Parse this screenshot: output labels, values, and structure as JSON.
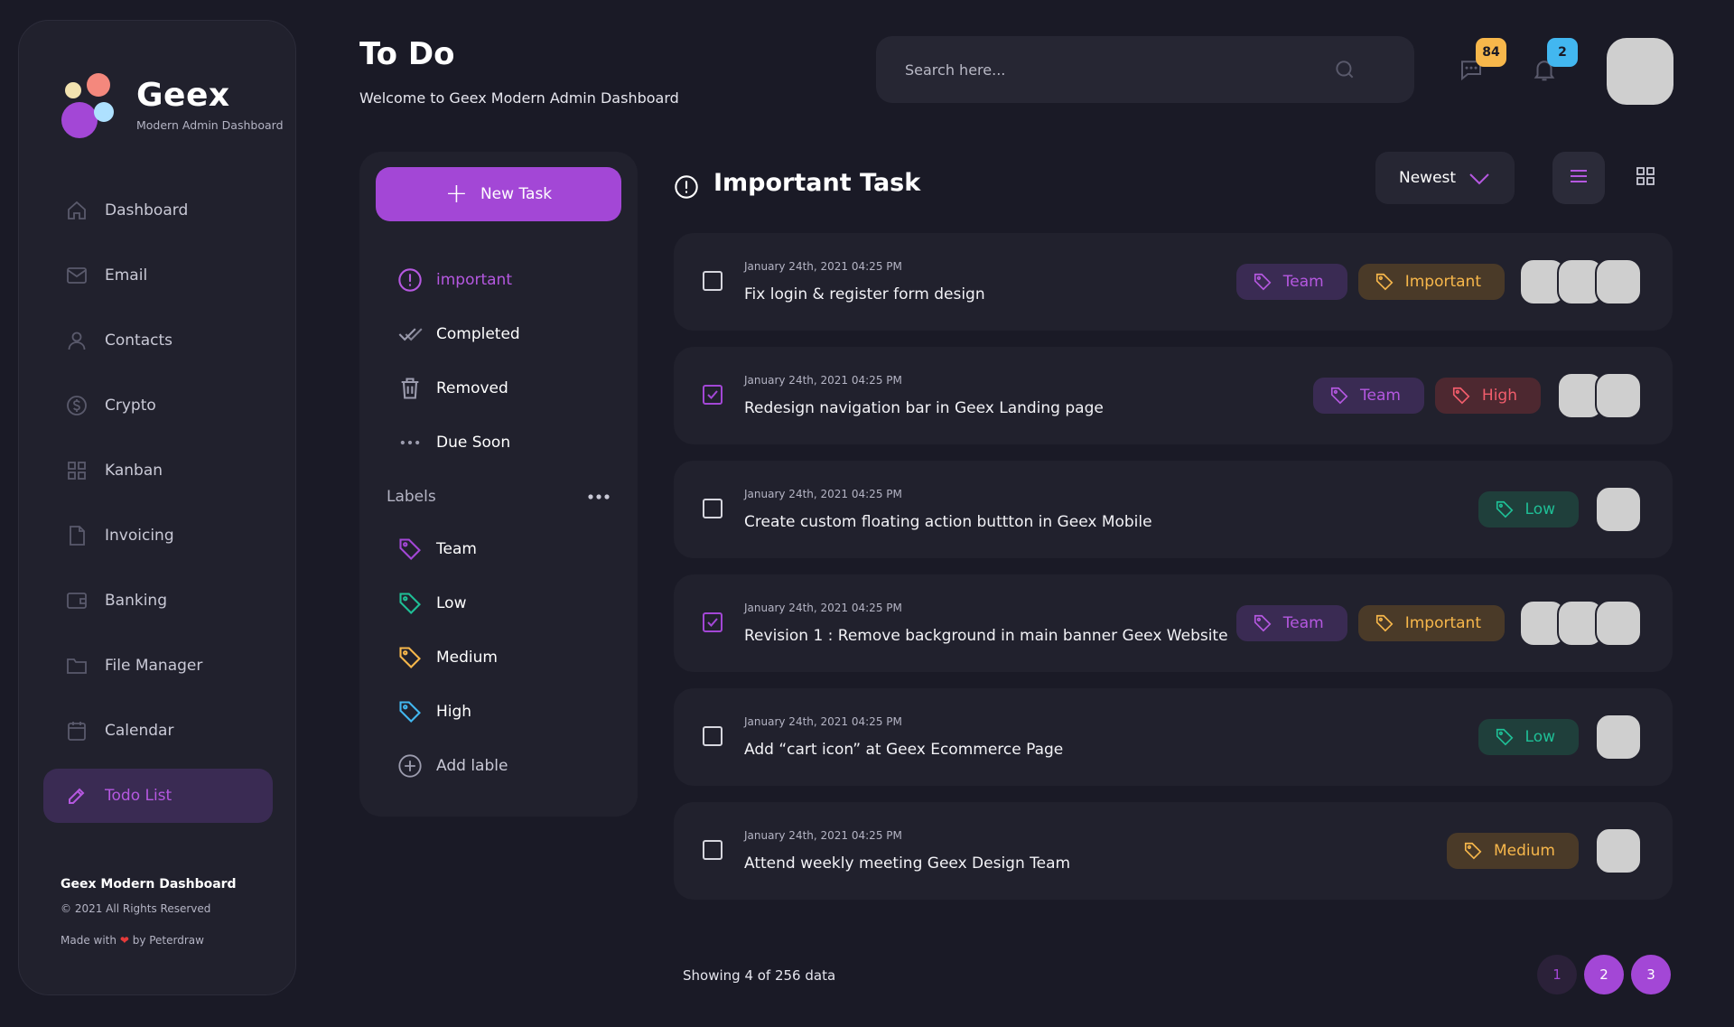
{
  "brand": {
    "name": "Geex",
    "tagline": "Modern Admin Dashboard"
  },
  "sidebar": {
    "items": [
      {
        "label": "Dashboard",
        "icon": "home-icon"
      },
      {
        "label": "Email",
        "icon": "mail-icon"
      },
      {
        "label": "Contacts",
        "icon": "user-icon"
      },
      {
        "label": "Crypto",
        "icon": "coin-icon"
      },
      {
        "label": "Kanban",
        "icon": "grid-icon"
      },
      {
        "label": "Invoicing",
        "icon": "document-icon"
      },
      {
        "label": "Banking",
        "icon": "wallet-icon"
      },
      {
        "label": "File Manager",
        "icon": "folder-icon"
      },
      {
        "label": "Calendar",
        "icon": "calendar-icon"
      },
      {
        "label": "Todo List",
        "icon": "pencil-icon",
        "active": true
      }
    ],
    "footer": {
      "title": "Geex Modern Dashboard",
      "copyright": "© 2021 All Rights Reserved",
      "made_with_prefix": "Made with",
      "made_with_suffix": "by Peterdraw"
    }
  },
  "header": {
    "title": "To Do",
    "subtitle": "Welcome to Geex Modern Admin Dashboard",
    "search_placeholder": "Search here...",
    "messages_count": "84",
    "notifications_count": "2"
  },
  "panel": {
    "new_task_label": "New Task",
    "filters": [
      {
        "label": "important",
        "icon": "alert-circle-icon",
        "active": true
      },
      {
        "label": "Completed",
        "icon": "double-check-icon"
      },
      {
        "label": "Removed",
        "icon": "trash-icon"
      },
      {
        "label": "Due Soon",
        "icon": "more-horizontal-icon"
      }
    ],
    "labels_heading": "Labels",
    "labels": [
      {
        "label": "Team",
        "color": "#a347d6"
      },
      {
        "label": "Low",
        "color": "#1fbf96"
      },
      {
        "label": "Medium",
        "color": "#f7b74b"
      },
      {
        "label": "High",
        "color": "#42b7f0"
      }
    ],
    "add_label": "Add lable"
  },
  "main": {
    "title": "Important Task",
    "sort_label": "Newest",
    "tasks": [
      {
        "date": "January 24th, 2021  04:25 PM",
        "title": "Fix login & register form design",
        "checked": false,
        "tags": [
          "Team",
          "Important"
        ],
        "assignees": 3
      },
      {
        "date": "January 24th, 2021  04:25 PM",
        "title": "Redesign navigation bar in Geex Landing page",
        "checked": true,
        "tags": [
          "Team",
          "High"
        ],
        "assignees": 2
      },
      {
        "date": "January 24th, 2021  04:25 PM",
        "title": "Create custom floating action buttton in Geex Mobile",
        "checked": false,
        "tags": [
          "Low"
        ],
        "assignees": 1
      },
      {
        "date": "January 24th, 2021  04:25 PM",
        "title": "Revision 1 : Remove background in main banner Geex Website",
        "checked": true,
        "tags": [
          "Team",
          "Important"
        ],
        "assignees": 3
      },
      {
        "date": "January 24th, 2021  04:25 PM",
        "title": "Add “cart icon” at Geex Ecommerce Page",
        "checked": false,
        "tags": [
          "Low"
        ],
        "assignees": 1
      },
      {
        "date": "January 24th, 2021  04:25 PM",
        "title": "Attend weekly meeting Geex Design Team",
        "checked": false,
        "tags": [
          "Medium"
        ],
        "assignees": 1
      }
    ],
    "showing": "Showing 4 of 256 data",
    "pages": [
      "1",
      "2",
      "3"
    ]
  },
  "colors": {
    "accent": "#a347d6",
    "background": "#1a1a26",
    "card": "#21212d"
  }
}
